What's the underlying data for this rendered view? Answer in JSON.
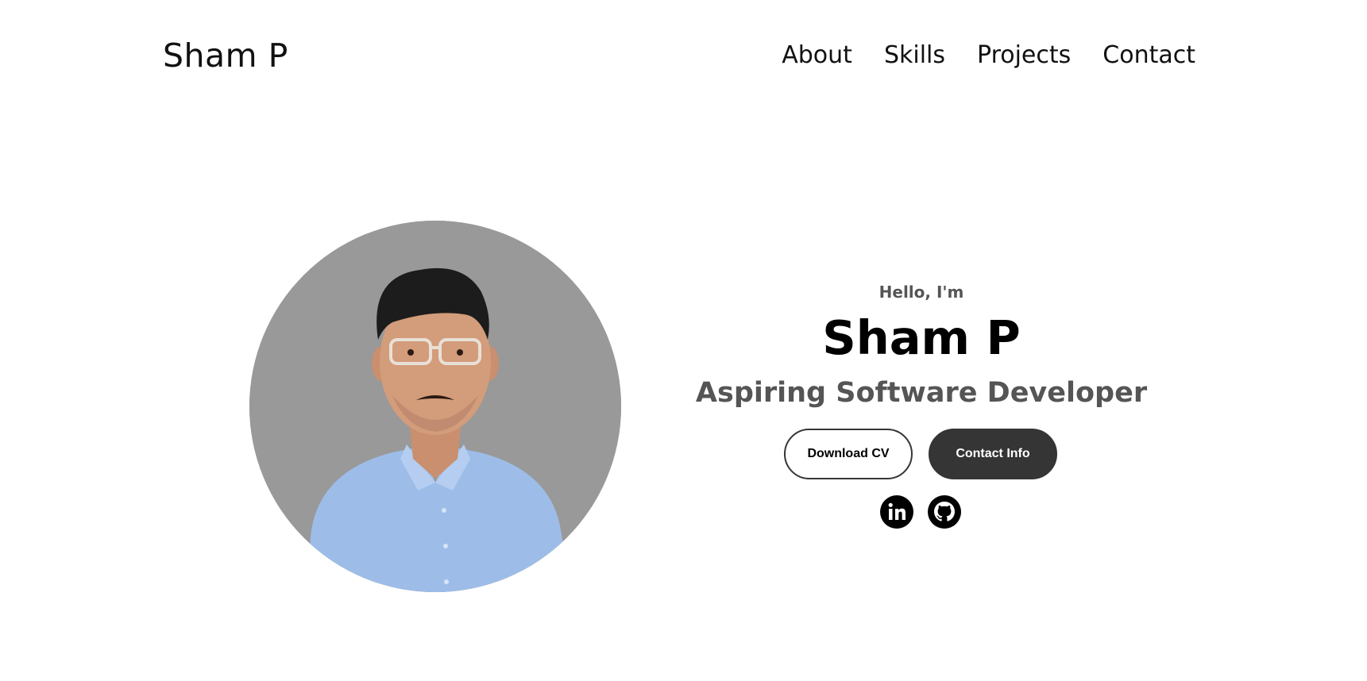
{
  "nav": {
    "logo": "Sham P",
    "links": [
      {
        "label": "About"
      },
      {
        "label": "Skills"
      },
      {
        "label": "Projects"
      },
      {
        "label": "Contact"
      }
    ]
  },
  "hero": {
    "greeting": "Hello, I'm",
    "name": "Sham P",
    "title": "Aspiring Software Developer",
    "buttons": {
      "download_cv": "Download CV",
      "contact_info": "Contact Info"
    },
    "socials": [
      {
        "icon": "linkedin-icon"
      },
      {
        "icon": "github-icon"
      }
    ],
    "profile_image": {
      "icon": "profile-photo"
    }
  },
  "colors": {
    "text_primary": "#000000",
    "text_secondary": "#555555",
    "button_dark": "#353535",
    "photo_background": "#999999",
    "shirt": "#9dbde8"
  }
}
